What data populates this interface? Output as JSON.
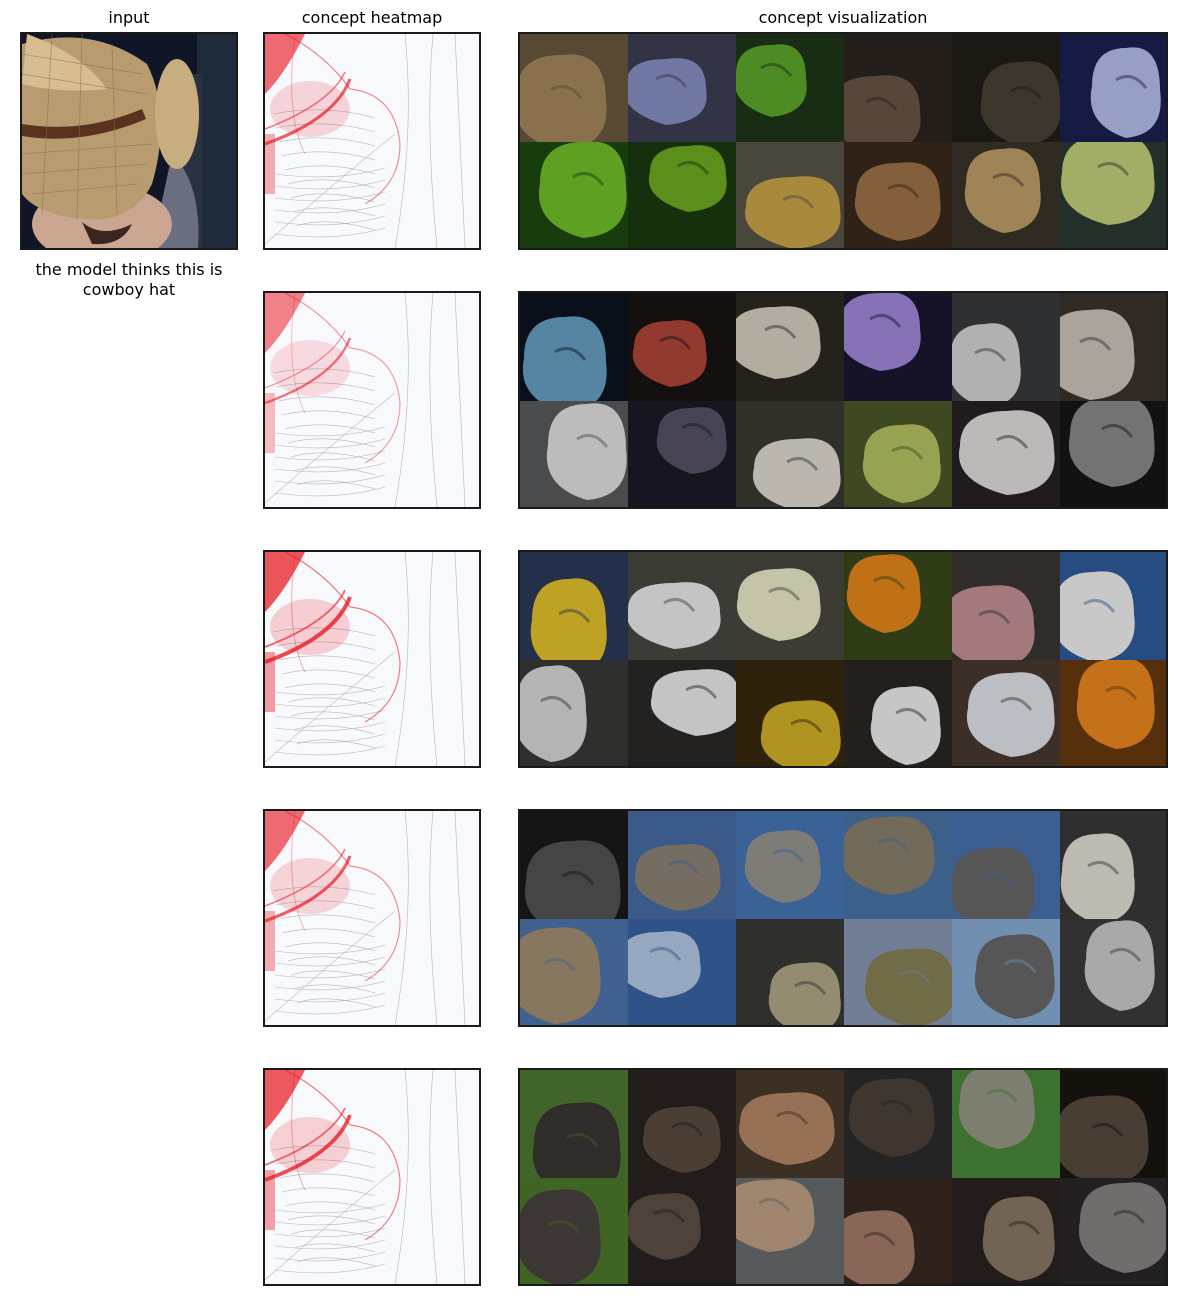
{
  "header": {
    "input_title": "input",
    "heatmap_title": "concept heatmap",
    "visualization_title": "concept visualization"
  },
  "input": {
    "caption": "the model thinks this is cowboy hat",
    "image_icon": "straw-cowboy-hat-photo"
  },
  "colors": {
    "heat": "#e8141e",
    "panel_border": "#1a1a1a",
    "dim_overlay": "#000000"
  },
  "concept_rows": [
    {
      "heatmap_icon": "hat-edge-heatmap",
      "heat_strength": 0.55,
      "tiles": [
        {
          "icon": "snake-coil-photo",
          "bg": "#6b5a40",
          "fg": "#a88a5e"
        },
        {
          "icon": "blue-fabric-photo",
          "bg": "#3e3f55",
          "fg": "#8a93c9"
        },
        {
          "icon": "green-snake-photo",
          "bg": "#1e3818",
          "fg": "#5faa2c"
        },
        {
          "icon": "dark-snake-photo",
          "bg": "#2b2520",
          "fg": "#6b5646"
        },
        {
          "icon": "snake-coil-photo",
          "bg": "#231f1a",
          "fg": "#4a4338"
        },
        {
          "icon": "blue-cloth-label-photo",
          "bg": "#1c2152",
          "fg": "#b9c2ef"
        },
        {
          "icon": "green-snake-photo",
          "bg": "#1e4a12",
          "fg": "#72c42a"
        },
        {
          "icon": "green-snake-photo",
          "bg": "#1b3a10",
          "fg": "#6fae22"
        },
        {
          "icon": "yellow-snake-photo",
          "bg": "#5a5648",
          "fg": "#cfa94a"
        },
        {
          "icon": "brown-snake-photo",
          "bg": "#3b2a1c",
          "fg": "#a27548"
        },
        {
          "icon": "sand-snake-photo",
          "bg": "#3a342a",
          "fg": "#c2a16c"
        },
        {
          "icon": "pale-green-snake-photo",
          "bg": "#2c3a34",
          "fg": "#c6d37c"
        }
      ]
    },
    {
      "heatmap_icon": "hat-edge-heatmap",
      "heat_strength": 0.35,
      "tiles": [
        {
          "icon": "blue-stripes-photo",
          "bg": "#0c1420",
          "fg": "#6aa3c8"
        },
        {
          "icon": "striped-feathers-photo",
          "bg": "#1a1414",
          "fg": "#b3473a"
        },
        {
          "icon": "zebra-photo",
          "bg": "#2e2a22",
          "fg": "#d9d4c4"
        },
        {
          "icon": "purple-lionfish-photo",
          "bg": "#1b1630",
          "fg": "#a58be0"
        },
        {
          "icon": "cruise-ship-photo",
          "bg": "#3a3b3d",
          "fg": "#d8d8d8"
        },
        {
          "icon": "zebra-photo",
          "bg": "#3a342c",
          "fg": "#cfcac0"
        },
        {
          "icon": "cruise-ship-photo",
          "bg": "#5b5c5e",
          "fg": "#e6e6e6"
        },
        {
          "icon": "striped-shell-photo",
          "bg": "#1d1a26",
          "fg": "#5a5468"
        },
        {
          "icon": "zebra-photo",
          "bg": "#3c3a34",
          "fg": "#e4e0d6"
        },
        {
          "icon": "zebras-grass-photo",
          "bg": "#4c5a2a",
          "fg": "#b9c766"
        },
        {
          "icon": "zebra-stripes-photo",
          "bg": "#2a2224",
          "fg": "#e8e2e2"
        },
        {
          "icon": "fan-grille-photo",
          "bg": "#161616",
          "fg": "#8d8d8d"
        }
      ]
    },
    {
      "heatmap_icon": "hat-edge-heatmap",
      "heat_strength": 0.75,
      "tiles": [
        {
          "icon": "lemons-bowl-photo",
          "bg": "#2d3b5a",
          "fg": "#e8c62c"
        },
        {
          "icon": "white-paper-photo",
          "bg": "#4a4a44",
          "fg": "#efefef"
        },
        {
          "icon": "pale-yellow-paper-photo",
          "bg": "#4a4a40",
          "fg": "#f1f0cf"
        },
        {
          "icon": "orange-fruit-photo",
          "bg": "#3b4a1c",
          "fg": "#ec8a1a"
        },
        {
          "icon": "pink-cloth-photo",
          "bg": "#3a3634",
          "fg": "#c99499"
        },
        {
          "icon": "paper-towel-roll-photo",
          "bg": "#2f5d9e",
          "fg": "#f4f4f4"
        },
        {
          "icon": "white-tube-photo",
          "bg": "#3a3a38",
          "fg": "#dcdcdc"
        },
        {
          "icon": "white-crib-photo",
          "bg": "#2c2a28",
          "fg": "#f0f0f0"
        },
        {
          "icon": "lemon-photo",
          "bg": "#3a2a10",
          "fg": "#d7b52a"
        },
        {
          "icon": "paper-towel-roll-photo",
          "bg": "#2a2624",
          "fg": "#f2f2f2"
        },
        {
          "icon": "paper-towel-roll-photo",
          "bg": "#4a3a30",
          "fg": "#e4e8ee"
        },
        {
          "icon": "orange-fruit-photo",
          "bg": "#6a3a10",
          "fg": "#f08a20"
        }
      ]
    },
    {
      "heatmap_icon": "hat-edge-heatmap",
      "heat_strength": 0.55,
      "tiles": [
        {
          "icon": "perforated-dome-photo",
          "bg": "#1a1a1a",
          "fg": "#555555"
        },
        {
          "icon": "planetarium-dome-photo",
          "bg": "#4a6ea8",
          "fg": "#8f8677"
        },
        {
          "icon": "planetarium-dome-photo",
          "bg": "#4978b8",
          "fg": "#9a9892"
        },
        {
          "icon": "planetarium-dome-photo",
          "bg": "#4a76a8",
          "fg": "#8b8270"
        },
        {
          "icon": "planetarium-dome-photo",
          "bg": "#4a73b0",
          "fg": "#6a6a6a"
        },
        {
          "icon": "white-dome-photo",
          "bg": "#3a3a3a",
          "fg": "#e7e3da"
        },
        {
          "icon": "planetarium-dome-photo",
          "bg": "#5077b0",
          "fg": "#a59274"
        },
        {
          "icon": "glass-dome-photo",
          "bg": "#3a64a8",
          "fg": "#b6cdea"
        },
        {
          "icon": "perforated-dome-photo",
          "bg": "#3a3a38",
          "fg": "#b4ab8a"
        },
        {
          "icon": "green-dome-photo",
          "bg": "#8a9ab8",
          "fg": "#8a8458"
        },
        {
          "icon": "planetarium-dome-photo",
          "bg": "#8ab0d8",
          "fg": "#6a6a6a"
        },
        {
          "icon": "perforated-dome-photo",
          "bg": "#3c3c3c",
          "fg": "#cfcfcf"
        }
      ]
    },
    {
      "heatmap_icon": "hat-edge-heatmap",
      "heat_strength": 0.7,
      "tiles": [
        {
          "icon": "water-buffalo-photo",
          "bg": "#4f7a34",
          "fg": "#3a3634"
        },
        {
          "icon": "buffalo-horn-photo",
          "bg": "#2a2420",
          "fg": "#5c4c40"
        },
        {
          "icon": "woman-cowboy-hat-photo",
          "bg": "#4a3a2c",
          "fg": "#b88a6a"
        },
        {
          "icon": "water-buffalo-photo",
          "bg": "#2c2c2c",
          "fg": "#4c423a"
        },
        {
          "icon": "buffalo-horns-photo",
          "bg": "#4a8a3a",
          "fg": "#9a9c8a"
        },
        {
          "icon": "water-buffalo-photo",
          "bg": "#1a1612",
          "fg": "#5a4c40"
        },
        {
          "icon": "buffalo-pair-photo",
          "bg": "#4e7a2c",
          "fg": "#4a4440"
        },
        {
          "icon": "buffalo-legs-photo",
          "bg": "#2a2420",
          "fg": "#5e5248"
        },
        {
          "icon": "cowboy-couple-photo",
          "bg": "#6a6e70",
          "fg": "#c4a488"
        },
        {
          "icon": "elephant-skin-photo",
          "bg": "#3a2a24",
          "fg": "#a87e6c"
        },
        {
          "icon": "buffalo-horn-photo",
          "bg": "#2a2420",
          "fg": "#8a7a68"
        },
        {
          "icon": "ram-horn-photo",
          "bg": "#2a2828",
          "fg": "#8a8684"
        }
      ]
    }
  ]
}
